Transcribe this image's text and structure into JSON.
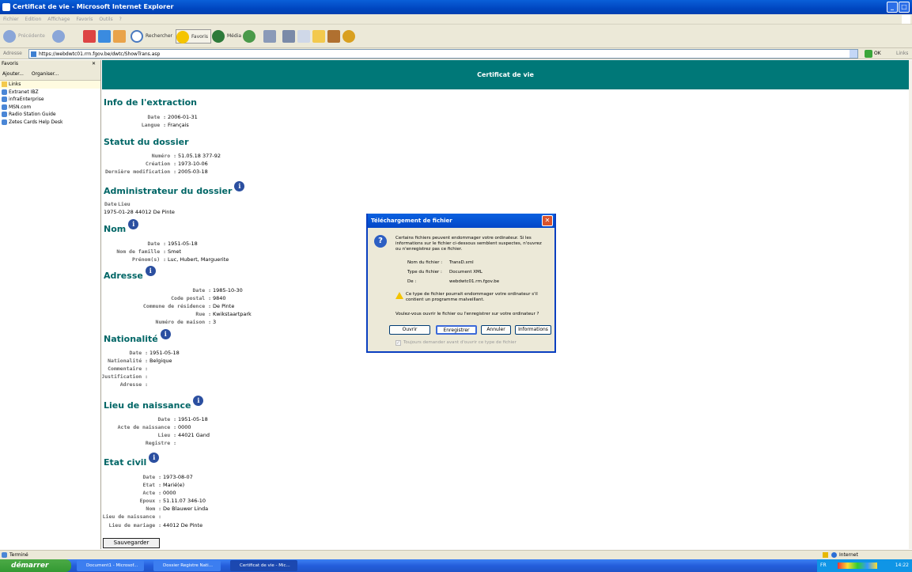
{
  "window": {
    "title": "Certificat de vie - Microsoft Internet Explorer"
  },
  "menu": [
    "Fichier",
    "Edition",
    "Affichage",
    "Favoris",
    "Outils",
    "?"
  ],
  "toolbar": {
    "back": "Précédente",
    "search": "Rechercher",
    "favorites": "Favoris",
    "media": "Média"
  },
  "address": {
    "label": "Adresse",
    "url": "https://webdwtc01.rrn.fgov.be/dwtc/ShowTrans.asp",
    "go": "OK",
    "links": "Links"
  },
  "favorites": {
    "title": "Favoris",
    "add": "Ajouter...",
    "organize": "Organiser...",
    "items": [
      "Links",
      "Extranet IBZ",
      "infraEnterprise",
      "MSN.com",
      "Radio Station Guide",
      "Zetes Cards Help Desk"
    ]
  },
  "page": {
    "banner": "Certificat de vie",
    "extraction": {
      "title": "Info de l'extraction",
      "date_label": "Date :",
      "date": "2006-01-31",
      "langue_label": "Langue :",
      "langue": "Français"
    },
    "statut": {
      "title": "Statut du dossier",
      "numero_label": "Numéro :",
      "numero": "51.05.18 377-92",
      "creation_label": "Création :",
      "creation": "1973-10-06",
      "modif_label": "Dernière modification :",
      "modif": "2005-03-18"
    },
    "admin": {
      "title": "Administrateur du dossier",
      "date_col": "Date",
      "lieu_col": "Lieu",
      "row": "1975-01-28 44012 De Pinte"
    },
    "nom": {
      "title": "Nom",
      "date_label": "Date :",
      "date": "1951-05-18",
      "famille_label": "Nom de famille :",
      "famille": "Smet",
      "prenoms_label": "Prénom(s) :",
      "prenoms": "Luc, Hubert, Marguerite"
    },
    "adresse": {
      "title": "Adresse",
      "date_label": "Date :",
      "date": "1985-10-30",
      "cp_label": "Code postal :",
      "cp": "9840",
      "commune_label": "Commune de résidence :",
      "commune": "De Pinte",
      "rue_label": "Rue :",
      "rue": "Kwikstaartpark",
      "num_label": "Numéro de maison :",
      "num": "3"
    },
    "nationalite": {
      "title": "Nationalité",
      "date_label": "Date :",
      "date": "1951-05-18",
      "nat_label": "Nationalité :",
      "nat": "Belgique",
      "comm_label": "Commentaire :",
      "just_label": "Justification :",
      "adr_label": "Adresse :"
    },
    "naissance": {
      "title": "Lieu de naissance",
      "date_label": "Date :",
      "date": "1951-05-18",
      "acte_label": "Acte de naissance :",
      "acte": "0000",
      "lieu_label": "Lieu :",
      "lieu": "44021 Gand",
      "reg_label": "Registre :"
    },
    "etatcivil": {
      "title": "Etat civil",
      "date_label": "Date :",
      "date": "1973-08-07",
      "etat_label": "Etat :",
      "etat": "Marié(e)",
      "acte_label": "Acte :",
      "acte": "0000",
      "epoux_label": "Epoux :",
      "epoux": "51.11.07 346-10",
      "nom_label": "Nom :",
      "nom": "De Blauwer Linda",
      "lieunais_label": "Lieu de naissance :",
      "lieumar_label": "Lieu de mariage :",
      "lieumar": "44012 De Pinte"
    },
    "save": "Sauvegarder"
  },
  "dialog": {
    "title": "Téléchargement de fichier",
    "msg1": "Certains fichiers peuvent endommager votre ordinateur. Si les",
    "msg2": "informations sur le fichier ci-dessous semblent suspectes, n'ouvrez",
    "msg3": "ou n'enregistrez pas ce fichier.",
    "name_label": "Nom du fichier :",
    "name": "TransD.xml",
    "type_label": "Type du fichier :",
    "type": "Document XML",
    "from_label": "De :",
    "from": "webdwtc01.rrn.fgov.be",
    "warn1": "Ce type de fichier pourrait endommager votre ordinateur s'il",
    "warn2": "contient un programme malveillant.",
    "question": "Voulez-vous ouvrir le fichier ou l'enregistrer sur votre ordinateur ?",
    "btn_open": "Ouvrir",
    "btn_save": "Enregistrer",
    "btn_cancel": "Annuler",
    "btn_info": "Informations",
    "checkbox": "Toujours demander avant d'ouvrir ce type de fichier"
  },
  "status": {
    "left": "Terminé",
    "zone": "Internet"
  },
  "taskbar": {
    "start": "démarrer",
    "items": [
      "Document1 - Microsof...",
      "Dossier Registre Nati...",
      "Certificat de vie - Mic..."
    ],
    "lang": "FR",
    "time": "14:22"
  }
}
